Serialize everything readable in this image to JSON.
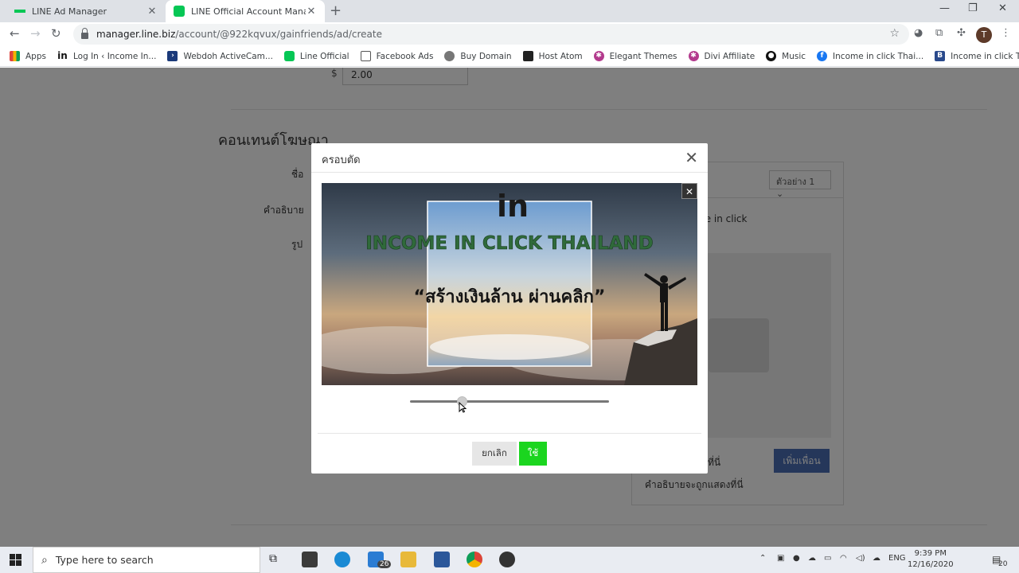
{
  "browser": {
    "tabs": [
      {
        "label": "LINE Ad Manager"
      },
      {
        "label": "LINE Official Account Manager"
      }
    ],
    "url_host": "manager.line.biz",
    "url_path": "/account/@922kqvux/gainfriends/ad/create",
    "profile_initial": "T",
    "bookmarks": [
      {
        "label": "Apps",
        "icon": "apps-grid-icon",
        "color": "#e0443e"
      },
      {
        "label": "Log In ‹ Income In...",
        "icon": "in-logo-icon",
        "color": "#111111"
      },
      {
        "label": "Webdoh ActiveCam...",
        "icon": "arrow-icon",
        "color": "#1b3a7a"
      },
      {
        "label": "Line Official",
        "icon": "line-icon",
        "color": "#06c755"
      },
      {
        "label": "Facebook Ads",
        "icon": "ads-icon",
        "color": "#555555"
      },
      {
        "label": "Buy Domain",
        "icon": "globe-icon",
        "color": "#555555"
      },
      {
        "label": "Host Atom",
        "icon": "grid-icon",
        "color": "#222222"
      },
      {
        "label": "Elegant Themes",
        "icon": "elegant-icon",
        "color": "#b33a8d"
      },
      {
        "label": "Divi Affiliate",
        "icon": "divi-icon",
        "color": "#b33a8d"
      },
      {
        "label": "Music",
        "icon": "music-icon",
        "color": "#111111"
      },
      {
        "label": "Income in click Thai...",
        "icon": "facebook-icon",
        "color": "#1877f2"
      },
      {
        "label": "Income in click Thai...",
        "icon": "blogger-b-icon",
        "color": "#2a4a8c"
      }
    ]
  },
  "page": {
    "bid_currency": "$",
    "bid_value": "2.00",
    "section_heading": "คอนเทนต์โฆษณา",
    "label_name": "ชื่อ",
    "label_description": "คำอธิบาย",
    "label_image": "รูป",
    "preview": {
      "sample_select": "ตัวอย่าง 1",
      "account_name": "me in click",
      "add_friend_button": "เพิ่มเพื่อน",
      "title_placeholder": "ที่นี่",
      "description_placeholder": "คำอธิบายจะถูกแสดงที่นี่"
    }
  },
  "modal": {
    "title": "ครอบตัด",
    "image_logo": "in",
    "image_headline": "INCOME IN CLICK THAILAND",
    "image_tagline": "“สร้างเงินล้าน ผ่านคลิก”",
    "zoom_level": 0.25,
    "cancel_label": "ยกเลิก",
    "apply_label": "ใช้"
  },
  "taskbar": {
    "search_placeholder": "Type here to search",
    "mail_badge": "26",
    "language": "ENG",
    "time": "9:39 PM",
    "date": "12/16/2020",
    "notification_count": "20"
  }
}
